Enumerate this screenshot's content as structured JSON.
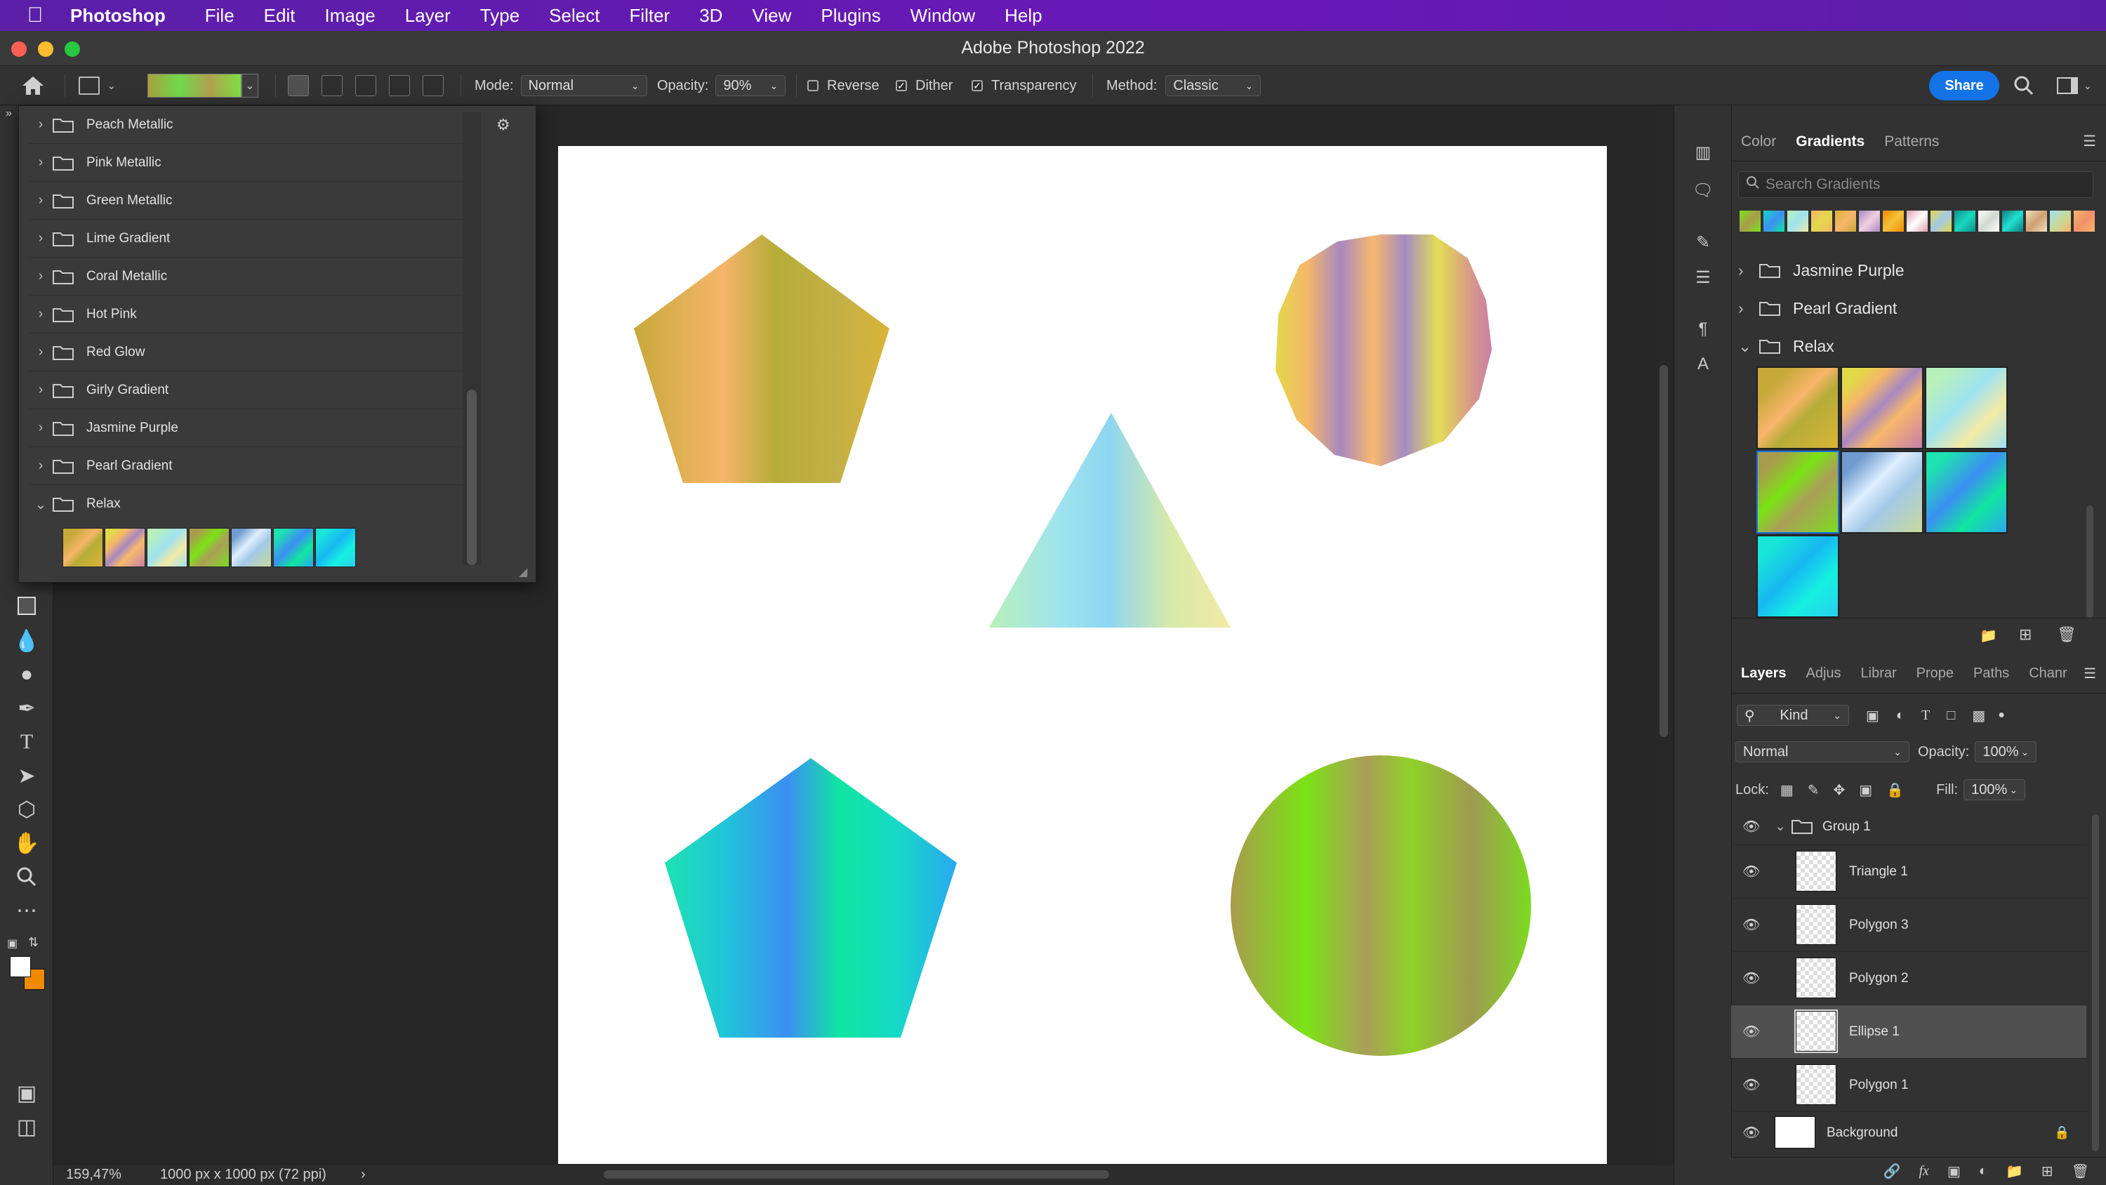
{
  "menubar": {
    "app_name": "Photoshop",
    "items": [
      "File",
      "Edit",
      "Image",
      "Layer",
      "Type",
      "Select",
      "Filter",
      "3D",
      "View",
      "Plugins",
      "Window",
      "Help"
    ]
  },
  "window": {
    "title": "Adobe Photoshop 2022"
  },
  "options": {
    "mode_label": "Mode:",
    "mode_value": "Normal",
    "opacity_label": "Opacity:",
    "opacity_value": "90%",
    "reverse_label": "Reverse",
    "reverse_checked": false,
    "dither_label": "Dither",
    "dither_checked": true,
    "transparency_label": "Transparency",
    "transparency_checked": true,
    "method_label": "Method:",
    "method_value": "Classic",
    "share_label": "Share"
  },
  "gradient_picker": {
    "folders": [
      "Peach Metallic",
      "Pink Metallic",
      "Green Metallic",
      "Lime Gradient",
      "Coral Metallic",
      "Hot Pink",
      "Red Glow",
      "Girly Gradient",
      "Jasmine Purple",
      "Pearl Gradient",
      "Relax"
    ],
    "expanded_folder": "Relax",
    "swatch_count": 7
  },
  "status": {
    "zoom": "159,47%",
    "doc_info": "1000 px x 1000 px (72 ppi)"
  },
  "gradients_panel": {
    "tabs": [
      "Color",
      "Gradients",
      "Patterns"
    ],
    "active_tab": "Gradients",
    "search_placeholder": "Search Gradients",
    "folders": [
      "Jasmine Purple",
      "Pearl Gradient",
      "Relax"
    ]
  },
  "layers_panel": {
    "tabs": [
      "Layers",
      "Adjus",
      "Librar",
      "Prope",
      "Paths",
      "Chanr"
    ],
    "active_tab": "Layers",
    "filter_label": "Kind",
    "blend_mode": "Normal",
    "opacity_label": "Opacity:",
    "opacity_value": "100%",
    "lock_label": "Lock:",
    "fill_label": "Fill:",
    "fill_value": "100%",
    "group_name": "Group 1",
    "layers": [
      "Triangle 1",
      "Polygon 3",
      "Polygon 2",
      "Ellipse 1",
      "Polygon 1"
    ],
    "selected_layer": "Ellipse 1",
    "background_layer": "Background"
  },
  "colors": {
    "menubar": "#5b1fa8",
    "accent_blue": "#1473e6",
    "foreground_swatch": "#ffffff",
    "background_swatch": "#f08a00"
  }
}
